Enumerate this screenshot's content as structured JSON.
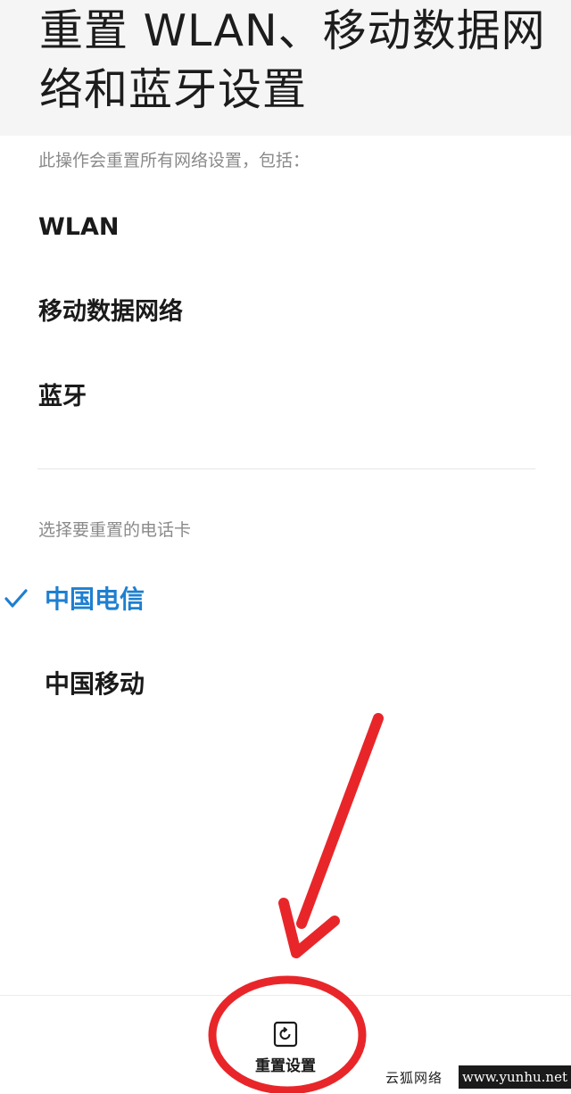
{
  "header": {
    "title": "重置 WLAN、移动数据网络和蓝牙设置"
  },
  "reset_scope": {
    "hint": "此操作会重置所有网络设置，包括：",
    "items": [
      "WLAN",
      "移动数据网络",
      "蓝牙"
    ]
  },
  "sim_selection": {
    "hint": "选择要重置的电话卡",
    "options": [
      {
        "label": "中国电信",
        "selected": true
      },
      {
        "label": "中国移动",
        "selected": false
      }
    ]
  },
  "bottom_bar": {
    "reset_button_label": "重置设置",
    "reset_icon": "reset-icon"
  },
  "colors": {
    "accent": "#1e7fd0",
    "annotation": "#e8262a",
    "header_bg": "#f5f5f5"
  },
  "watermark": {
    "site_name": "云狐网络",
    "url": "www.yunhu.net"
  }
}
